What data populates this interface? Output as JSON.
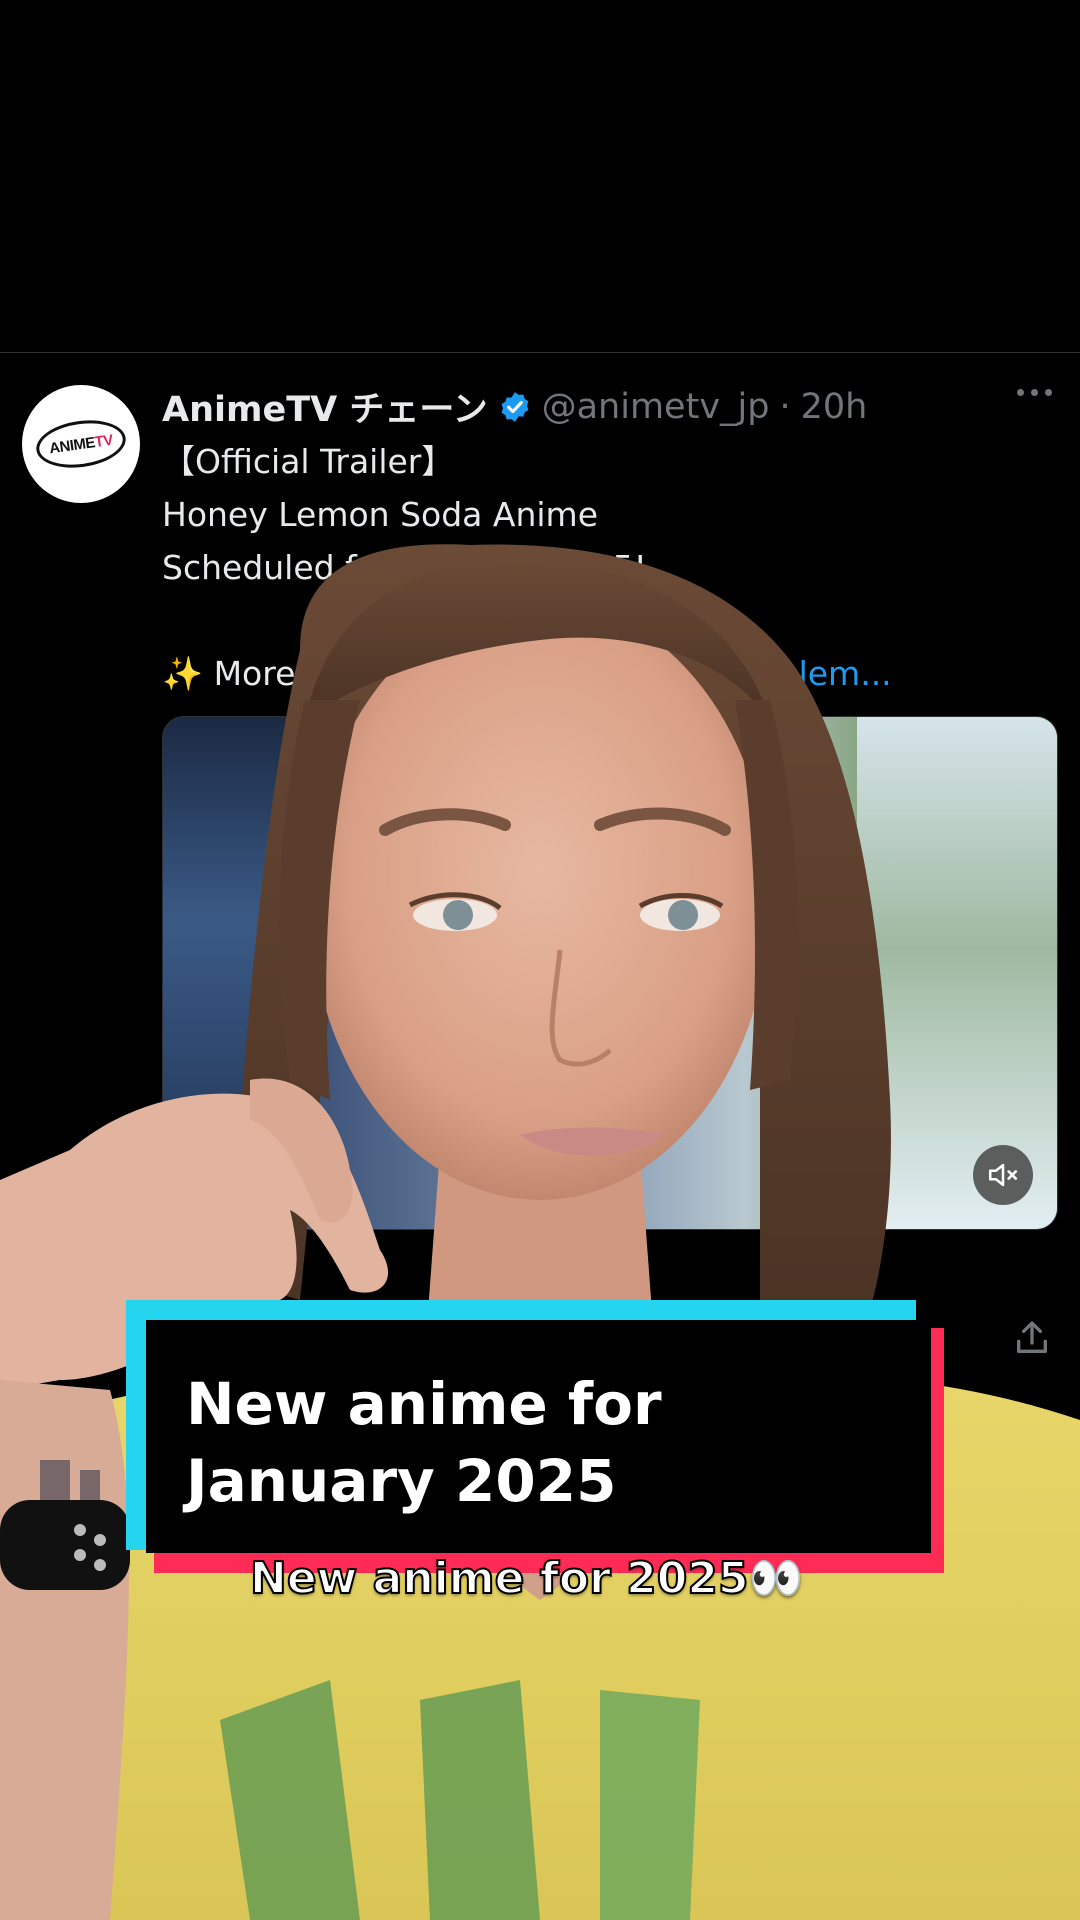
{
  "tweet": {
    "author_name": "AnimeTV チェーン",
    "handle": "@animetv_jp",
    "separator": "·",
    "time": "20h",
    "avatar_text_left": "ANIME",
    "avatar_text_right": "TV",
    "lines": [
      "【Official Trailer】",
      "Honey Lemon Soda Anime",
      "Scheduled for J",
      "025!"
    ],
    "more_prefix": "✨ More:",
    "more_link": "ney-lem..."
  },
  "caption": {
    "title": "New anime for January 2025",
    "subtitle": "New anime for 2025👀"
  },
  "colors": {
    "link": "#1d9bf0",
    "verified": "#1d9bf0",
    "caption_cyan": "#25d4ee",
    "caption_red": "#fe2c55"
  },
  "icons": [
    "verified-badge-icon",
    "more-options-icon",
    "mute-icon",
    "share-icon"
  ]
}
